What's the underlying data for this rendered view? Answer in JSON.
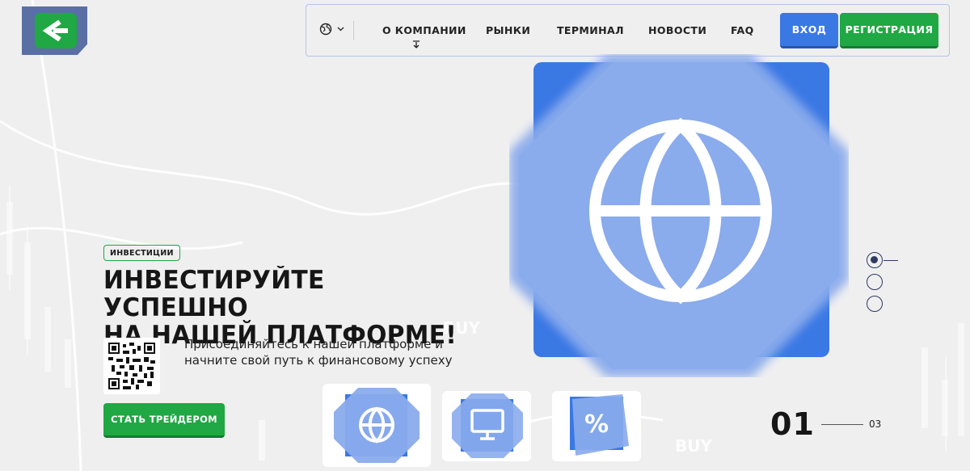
{
  "nav": {
    "items": [
      {
        "label": "О КОМПАНИИ"
      },
      {
        "label": "РЫНКИ"
      },
      {
        "label": "ТЕРМИНАЛ"
      },
      {
        "label": "НОВОСТИ"
      },
      {
        "label": "FAQ"
      }
    ],
    "login_label": "ВХОД",
    "register_label": "РЕГИСТРАЦИЯ",
    "language_icon": "globe-icon"
  },
  "hero": {
    "tag": "ИНВЕСТИЦИИ",
    "headline_line1": "ИНВЕСТИРУЙТЕ УСПЕШНО",
    "headline_line2": "НА НАШЕЙ ПЛАТФОРМЕ!",
    "subtitle_line1": "Присоединяйтесь к нашей платформе и",
    "subtitle_line2": "начните свой путь к финансовому успеху",
    "cta_label": "СТАТЬ ТРЕЙДЕРОМ",
    "main_icon": "globe-icon"
  },
  "slider": {
    "current": "01",
    "total": "03",
    "thumbs": [
      {
        "icon": "globe-icon"
      },
      {
        "icon": "monitor-icon"
      },
      {
        "icon": "percent-icon",
        "glyph": "%"
      }
    ]
  },
  "background": {
    "watermark1": "BUY",
    "watermark2": "BUY"
  },
  "colors": {
    "accent_blue": "#3a78e4",
    "accent_green": "#1fa843",
    "background": "#efeff0",
    "logo_bg": "#5a6fa3"
  }
}
